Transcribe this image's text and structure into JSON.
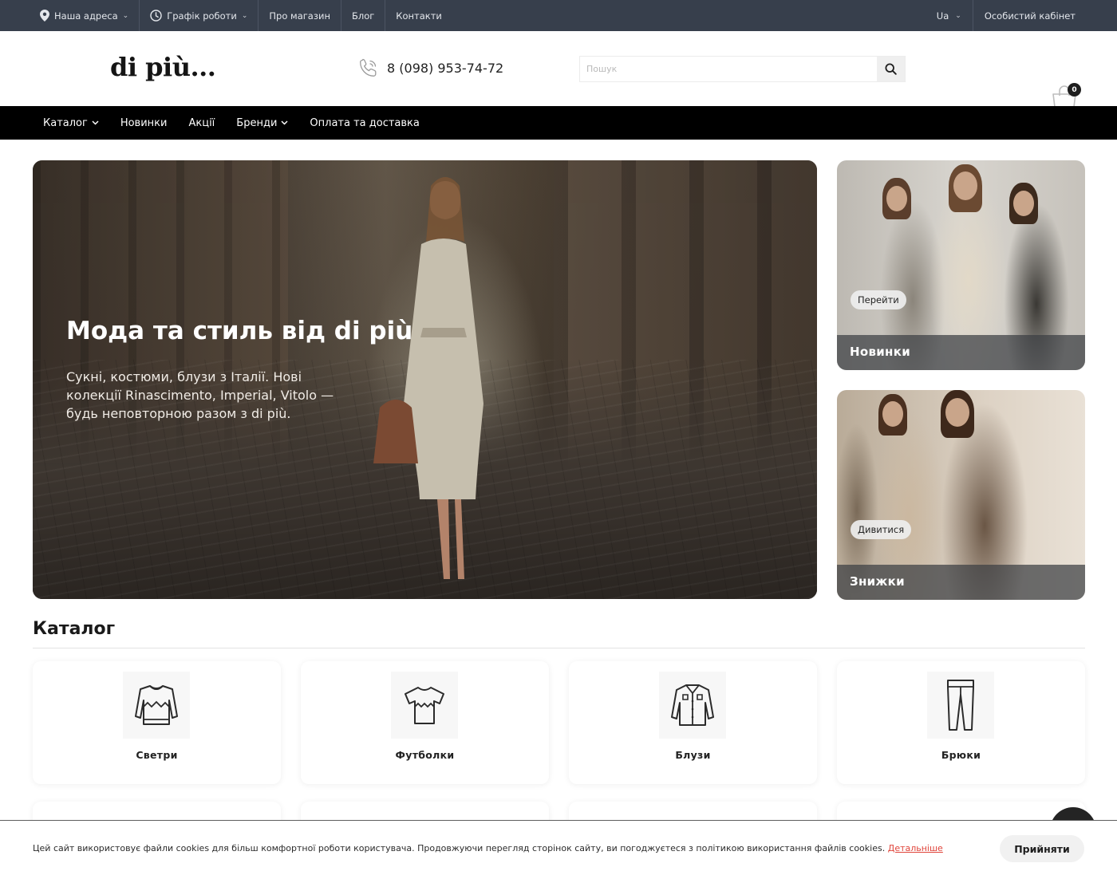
{
  "topbar": {
    "address_label": "Наша адреса",
    "schedule_label": "Графік роботи",
    "about_label": "Про магазин",
    "blog_label": "Блог",
    "contacts_label": "Контакти",
    "language": "Ua",
    "account_label": "Особистий кабінет"
  },
  "header": {
    "logo": "di più...",
    "phone": "8 (098) 953-74-72",
    "search_placeholder": "Пошук",
    "cart_count": "0"
  },
  "nav": {
    "items": [
      {
        "label": "Каталог",
        "has_dropdown": true
      },
      {
        "label": "Новинки",
        "has_dropdown": false
      },
      {
        "label": "Акції",
        "has_dropdown": false
      },
      {
        "label": "Бренди",
        "has_dropdown": true
      },
      {
        "label": "Оплата та доставка",
        "has_dropdown": false
      }
    ]
  },
  "hero": {
    "title": "Мода та стиль від di più",
    "text": "Сукні, костюми, блузи з Італії. Нові колекції Rinascimento, Imperial, Vitolo — будь неповторною разом з di più."
  },
  "promos": [
    {
      "pill": "Перейти",
      "label": "Новинки"
    },
    {
      "pill": "Дивитися",
      "label": "Знижки"
    }
  ],
  "catalog": {
    "title": "Каталог",
    "items": [
      {
        "label": "Светри",
        "icon": "sweater-icon"
      },
      {
        "label": "Футболки",
        "icon": "tshirt-icon"
      },
      {
        "label": "Блузи",
        "icon": "blouse-icon"
      },
      {
        "label": "Брюки",
        "icon": "trousers-icon"
      }
    ]
  },
  "cookie": {
    "text": "Цей сайт використовує файли cookies для більш комфортної роботи користувача. Продовжуючи перегляд сторінок сайту, ви погоджуєтеся з політикою використання файлів cookies.",
    "link": "Детальніше",
    "accept": "Прийняти"
  },
  "colors": {
    "topbar": "#373f4c",
    "nav": "#000000",
    "cookie_link": "#e0443a"
  }
}
